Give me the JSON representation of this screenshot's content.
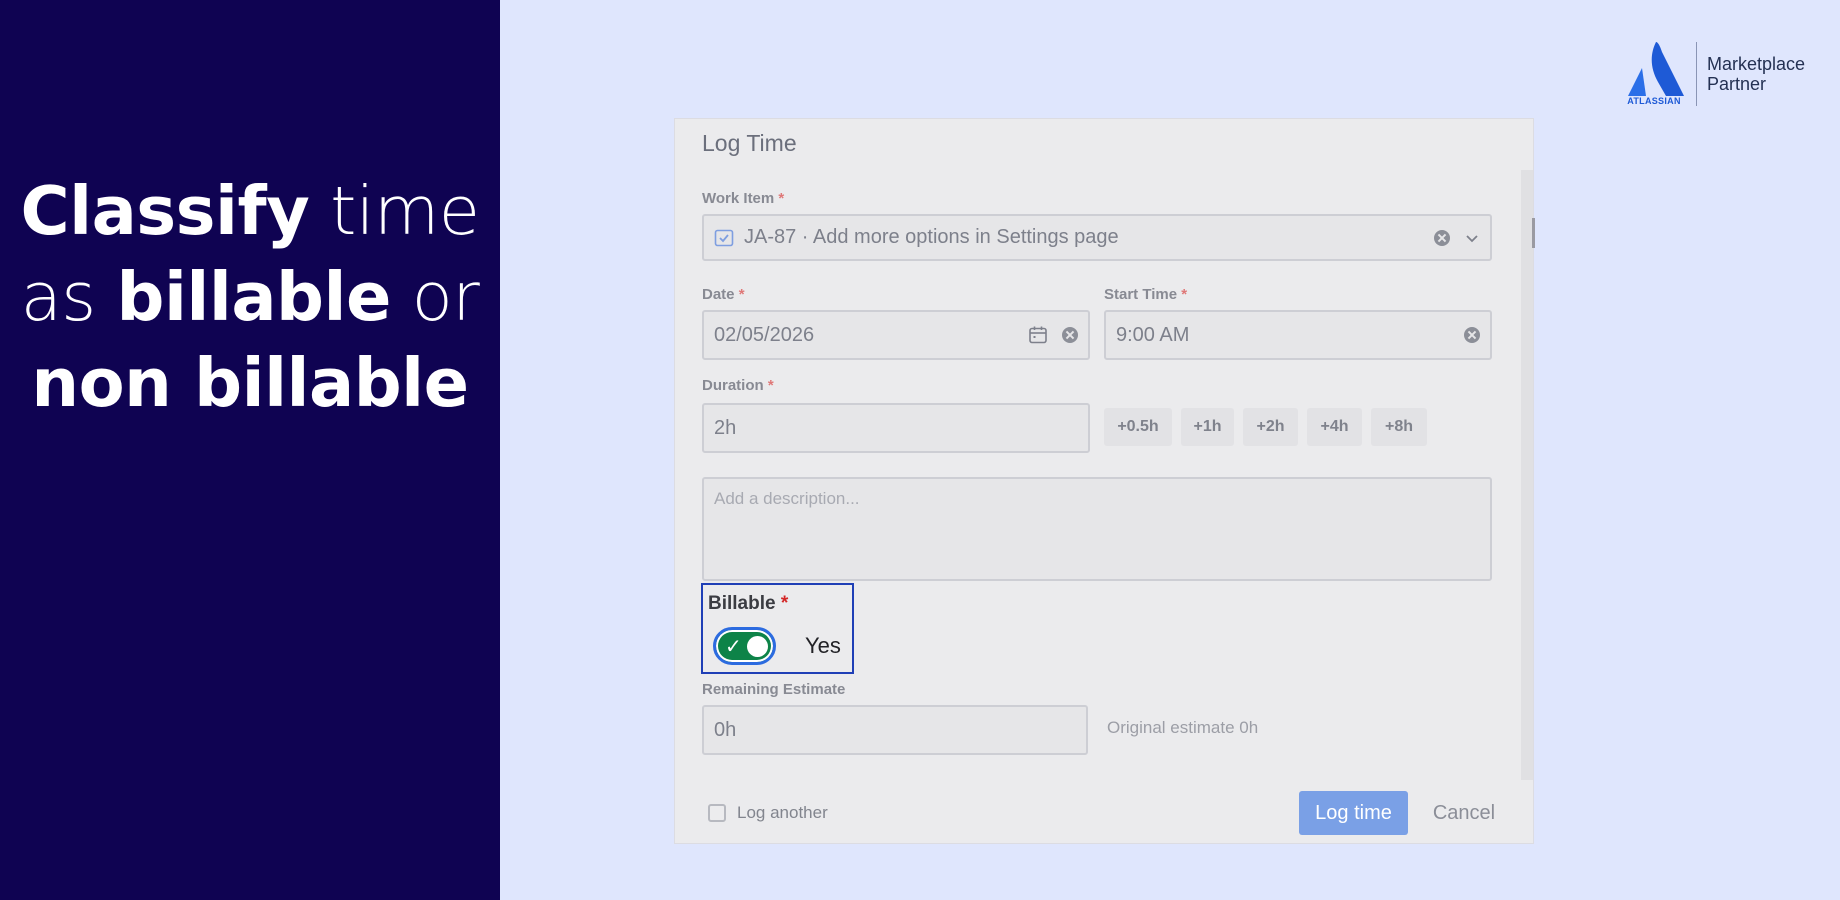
{
  "promo": {
    "line1_bold": "Classify",
    "line1_rest": " time",
    "line2_pre": "as ",
    "line2_bold": "billable",
    "line2_post": " or",
    "line3_bold": "non billable"
  },
  "partner": {
    "wordmark": "ATLASSIAN",
    "line1": "Marketplace",
    "line2": "Partner",
    "brand_color": "#1e5ad6"
  },
  "dialog": {
    "title": "Log Time",
    "required_marker": "*",
    "work_item": {
      "label": "Work Item",
      "value": "JA-87 · Add more options in Settings page",
      "icon": "checkbox-task-icon"
    },
    "date": {
      "label": "Date",
      "value": "02/05/2026"
    },
    "start_time": {
      "label": "Start Time",
      "value": "9:00 AM"
    },
    "duration": {
      "label": "Duration",
      "value": "2h",
      "quick_adds": [
        "+0.5h",
        "+1h",
        "+2h",
        "+4h",
        "+8h"
      ]
    },
    "description": {
      "placeholder": "Add a description..."
    },
    "billable": {
      "label": "Billable",
      "state_text": "Yes",
      "on": true,
      "on_color": "#0d8348",
      "focus_color": "#1f3fb6"
    },
    "remaining_estimate": {
      "label": "Remaining Estimate",
      "value": "0h",
      "original_text": "Original estimate 0h"
    },
    "log_another_label": "Log another",
    "submit_label": "Log time",
    "cancel_label": "Cancel"
  }
}
